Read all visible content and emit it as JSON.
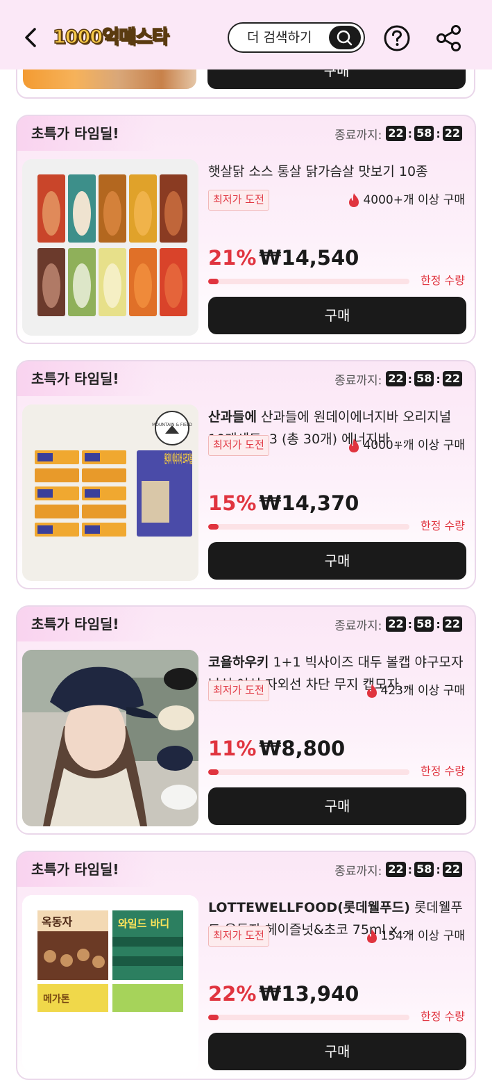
{
  "header": {
    "logo_text": "1000억메스타",
    "search_label": "더 검색하기"
  },
  "previous_card": {
    "buy_label": "구매"
  },
  "cards": [
    {
      "badge": "초특가 타임딜!",
      "timer_label": "종료까지:",
      "timer": [
        "22",
        "58",
        "22"
      ],
      "brand": "",
      "title": "햇살닭 소스 통살 닭가슴살 맛보기 10종",
      "tag": "최저가 도전",
      "sold": "4000+개 이상 구매",
      "discount": "21%",
      "price": "₩14,540",
      "progress": 0.05,
      "limited": "한정 수량",
      "buy_label": "구매"
    },
    {
      "badge": "초특가 타임딜!",
      "timer_label": "종료까지:",
      "timer": [
        "22",
        "58",
        "22"
      ],
      "brand": "산과들에",
      "title": "산과들에 원데이에너지바 오리지널 10개세트x3 (총 30개) 에너지바 ...",
      "tag": "최저가 도전",
      "sold": "4000+개 이상 구매",
      "discount": "15%",
      "price": "₩14,370",
      "progress": 0.05,
      "limited": "한정 수량",
      "buy_label": "구매",
      "image_text": {
        "mountain": "MOUNTAIN & FIELD",
        "product": "원데이 에너지바 오리지널"
      }
    },
    {
      "badge": "초특가 타임딜!",
      "timer_label": "종료까지:",
      "timer": [
        "22",
        "58",
        "22"
      ],
      "brand": "코욜하우키",
      "title": "1+1 빅사이즈 대두 볼캡 야구모자 남성 여성 자외선 차단 무지 캡모자...",
      "tag": "최저가 도전",
      "sold": "423개 이상 구매",
      "discount": "11%",
      "price": "₩8,800",
      "progress": 0.05,
      "limited": "한정 수량",
      "buy_label": "구매"
    },
    {
      "badge": "초특가 타임딜!",
      "timer_label": "종료까지:",
      "timer": [
        "22",
        "58",
        "22"
      ],
      "brand": "LOTTEWELLFOOD(롯데웰푸드)",
      "title": "롯데웰푸드 옥동자 헤이즐넛&초코 75ml x ...",
      "tag": "최저가 도전",
      "sold": "154개 이상 구매",
      "discount": "22%",
      "price": "₩13,940",
      "progress": 0.05,
      "limited": "한정 수량",
      "buy_label": "구매",
      "image_text": {
        "left": "옥동자",
        "right": "와일드 바디",
        "bottom": "메가톤"
      }
    }
  ],
  "colors": {
    "accent": "#e0343f",
    "header_bg": "#fbe8f7",
    "button": "#1a1a1a"
  }
}
